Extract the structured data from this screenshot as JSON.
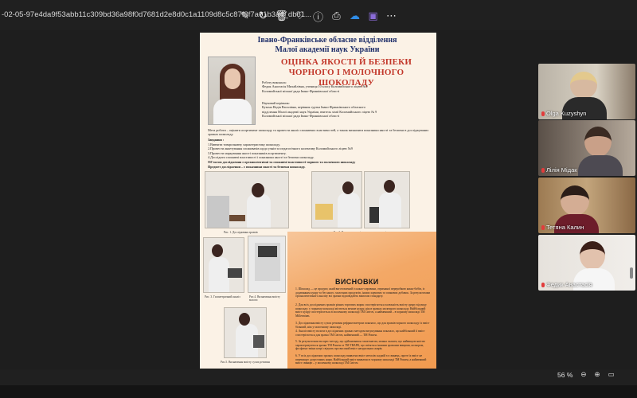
{
  "window": {
    "filename": "-02-05-97e4da9f53abb11c309bd36a98f0d7681d2e8d0c1a1109d8c5c87f8f7a61b3a4_db61..."
  },
  "toolbar": {
    "icons": [
      "edit-icon",
      "rotate-icon",
      "delete-icon",
      "favorite-icon",
      "info-icon",
      "print-icon",
      "onedrive-icon",
      "edit-app-icon",
      "more-icon"
    ],
    "glyphs": [
      "✎",
      "↻",
      "🗑",
      "♡",
      "ⓘ",
      "⎙",
      "☁",
      "▣",
      "⋯"
    ]
  },
  "poster": {
    "org_line1": "Івано-Франківське обласне відділення",
    "org_line2": "Малої академії наук України",
    "title_line1": "ОЦІНКА ЯКОСТІ Й БЕЗПЕКИ",
    "title_line2": "ЧОРНОГО І МОЛОЧНОГО ШОКОЛАДУ",
    "author_block": "Роботу виконала:\nФедик Анастасія Михайлівна, учениця 10 класу Коломийського ліцею №9\nКоломийської міської ради Івано-Франківської області",
    "advisor_block": "Науковий керівник:\nКузьма Надія Василівна, керівник гуртка Івано-Франківського обласного\nвідділення Малої академії наук України, вчитель хімії Коломийського ліцею № 9\nКоломийської міської ради Івано-Франківської області",
    "goal": "Мета роботи – оцінити асортимент шоколаду та провести аналіз споживчих властивостей, а також визначити показники якості та безпеки в досліджуваних зразках шоколаду.",
    "tasks_title": "Завдання :",
    "tasks": "1.Вивчити товарознавчу характеристику шоколаду.\n2.Провести анкетування споживачів щодо учнів та педагогічного колективу Коломийського ліцею №9\n3.Провести маркування якості показників асортименту.\n4.Дослідити споживчі властивості і показники якості та безпеки шоколаду.",
    "object": "Об'єктом дослідження є органолептичні та споживчі властивості чорного та молочного шоколаду",
    "subject": "Предмет дослідження – є показники якості та безпеки шоколаду.",
    "fig1": "Рис. 1. Дослідження зразків",
    "fig2": "Рис.2. Визначення вмісту цукру в шоколаді",
    "fig3": "Рис. 3. Газометричний аналіз",
    "fig4": "Рис.4. Визначення вмісту вологи",
    "fig5": "Рис.5. Визначення вмісту сухих речовин",
    "conclusions_title": "ВИСНОВКИ",
    "conclusions": [
      "1. Шоколад — це продукт, який виготовлений із какао-сировини, отриманої переробкою какао-бобів, із додаванням цукру та без нього, молочних продуктів, інших харчових та смакових добавок. За результатами органолептичного аналізу всі зразки відповідають вимогам стандарту.",
      "2. Для всіх досліджених зразків різних торгових марок спостерігається залежність вмісту цукру від виду шоколаду: у чорному шоколаді міститься менше цукру, ніж в зразках молочного шоколаду. Найбільший вміст цукру спостерігається в молочному шоколаді ТМ Світоч, а найменший – в чорному шоколаді ТМ Millennium.",
      "3. Дослідження вмісту сухих речовин рефрактометром показало, що для зразків чорного шоколаду їх вміст більший, ніж у молочному шоколаді.",
      "4. Аналіз вмісту вологи в досліджених зразках методом висушування показало, що найбільший її вміст спостерігається для зразка ТМ Світоч, найменший — ТМ Рошен.",
      "5. За результатами експрес-методу, що здійснювався гомогенатом, можна сказати, що найвищою якістю характеризуються зразки ТМ Рошен та ТМ ТВАРК, що світяться іншими зразками вищими, кольором, фосфатно-зміни котрі свідчать про високий вміст натуральних жирів.",
      "6. У всіх досліджених зразках шоколаду виявлено вміст металів: кадмій та свинець, проте їх вміст не перевищує допустимих норм. Найбільший вміст виявлено в чорному шоколаді ТМ Рошен, а найменший вміст свинцю – у молочному шоколаді ТМ Світоч."
    ]
  },
  "participants": [
    {
      "name": "Olga Kuzyshyn"
    },
    {
      "name": "Лілія Мідак"
    },
    {
      "name": "Тетяна Калин"
    },
    {
      "name": "Федик Анастасія"
    }
  ],
  "status": {
    "zoom_level": "56 %"
  },
  "colors": {
    "title_red": "#c2372a",
    "org_blue": "#1f2f6a",
    "conclusion_orange": "#f19a4f",
    "mic_muted": "#e23b3b"
  }
}
